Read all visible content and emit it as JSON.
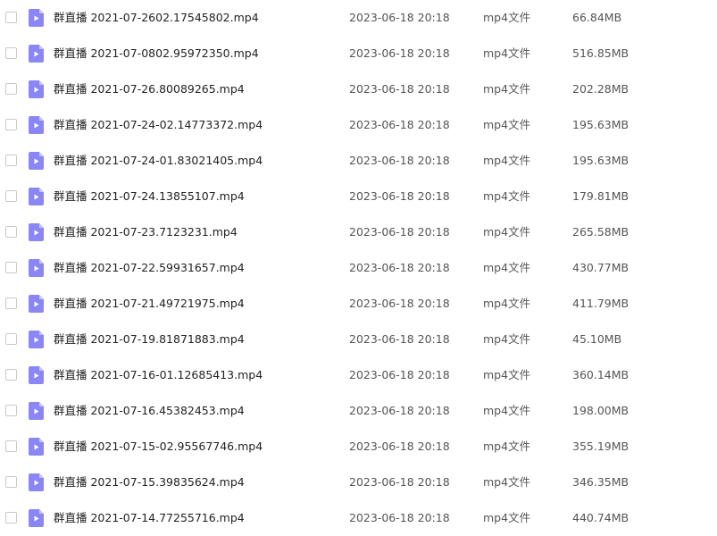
{
  "files": [
    {
      "name": "群直播 2021-07-2602.17545802.mp4",
      "date": "2023-06-18 20:18",
      "type": "mp4文件",
      "size": "66.84MB",
      "icon": "video-file-icon"
    },
    {
      "name": "群直播 2021-07-0802.95972350.mp4",
      "date": "2023-06-18 20:18",
      "type": "mp4文件",
      "size": "516.85MB",
      "icon": "video-file-icon"
    },
    {
      "name": "群直播 2021-07-26.80089265.mp4",
      "date": "2023-06-18 20:18",
      "type": "mp4文件",
      "size": "202.28MB",
      "icon": "video-file-icon"
    },
    {
      "name": "群直播 2021-07-24-02.14773372.mp4",
      "date": "2023-06-18 20:18",
      "type": "mp4文件",
      "size": "195.63MB",
      "icon": "video-file-icon"
    },
    {
      "name": "群直播 2021-07-24-01.83021405.mp4",
      "date": "2023-06-18 20:18",
      "type": "mp4文件",
      "size": "195.63MB",
      "icon": "video-file-icon"
    },
    {
      "name": "群直播 2021-07-24.13855107.mp4",
      "date": "2023-06-18 20:18",
      "type": "mp4文件",
      "size": "179.81MB",
      "icon": "video-file-icon"
    },
    {
      "name": "群直播 2021-07-23.7123231.mp4",
      "date": "2023-06-18 20:18",
      "type": "mp4文件",
      "size": "265.58MB",
      "icon": "video-file-icon"
    },
    {
      "name": "群直播 2021-07-22.59931657.mp4",
      "date": "2023-06-18 20:18",
      "type": "mp4文件",
      "size": "430.77MB",
      "icon": "video-file-icon"
    },
    {
      "name": "群直播 2021-07-21.49721975.mp4",
      "date": "2023-06-18 20:18",
      "type": "mp4文件",
      "size": "411.79MB",
      "icon": "video-file-icon"
    },
    {
      "name": "群直播 2021-07-19.81871883.mp4",
      "date": "2023-06-18 20:18",
      "type": "mp4文件",
      "size": "45.10MB",
      "icon": "video-file-icon"
    },
    {
      "name": "群直播 2021-07-16-01.12685413.mp4",
      "date": "2023-06-18 20:18",
      "type": "mp4文件",
      "size": "360.14MB",
      "icon": "video-file-icon"
    },
    {
      "name": "群直播 2021-07-16.45382453.mp4",
      "date": "2023-06-18 20:18",
      "type": "mp4文件",
      "size": "198.00MB",
      "icon": "video-file-icon"
    },
    {
      "name": "群直播 2021-07-15-02.95567746.mp4",
      "date": "2023-06-18 20:18",
      "type": "mp4文件",
      "size": "355.19MB",
      "icon": "video-file-icon"
    },
    {
      "name": "群直播 2021-07-15.39835624.mp4",
      "date": "2023-06-18 20:18",
      "type": "mp4文件",
      "size": "346.35MB",
      "icon": "video-file-icon"
    },
    {
      "name": "群直播 2021-07-14.77255716.mp4",
      "date": "2023-06-18 20:18",
      "type": "mp4文件",
      "size": "440.74MB",
      "icon": "video-file-icon"
    }
  ],
  "colors": {
    "icon_fill": "#8b86f5",
    "icon_fold": "#c4c1fb",
    "checkbox_border": "#c9c9c9",
    "text": "#222222",
    "meta_text": "#555555"
  }
}
